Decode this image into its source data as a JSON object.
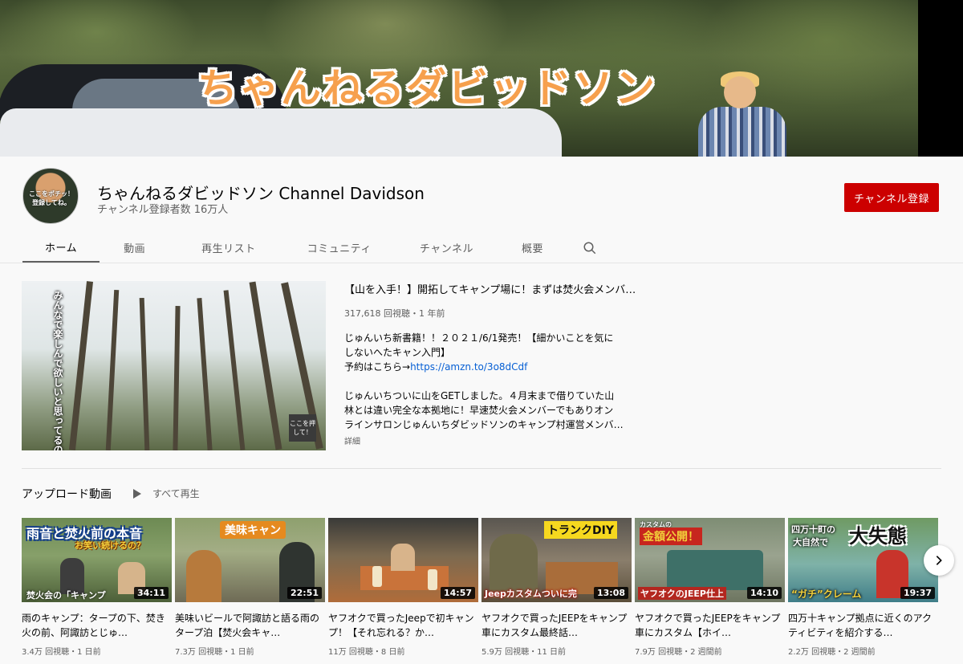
{
  "banner": {
    "title": "ちゃんねるダビッドソン"
  },
  "channel": {
    "name": "ちゃんねるダビッドソン Channel Davidson",
    "subscribers": "チャンネル登録者数 16万人",
    "avatar_text": "ここをポチッ！登録してね。",
    "subscribe_label": "チャンネル登録"
  },
  "tabs": [
    {
      "label": "ホーム",
      "active": true
    },
    {
      "label": "動画"
    },
    {
      "label": "再生リスト"
    },
    {
      "label": "コミュニティ"
    },
    {
      "label": "チャンネル"
    },
    {
      "label": "概要"
    }
  ],
  "featured": {
    "thumb_vertical_text": "みんなで楽しんで欲しいと思ってるので",
    "thumb_badge": "ここを押して！",
    "title": "【山を入手！】開拓してキャンプ場に！まずは焚火会メンバー…",
    "meta": "317,618 回視聴・1 年前",
    "desc_line1": "じゅんいち新書籍！！２０２１/6/1発売！【細かいことを気に",
    "desc_line2": "しないへたキャン入門】",
    "desc_line3_prefix": "予約はこちら→",
    "desc_link": "https://amzn.to/3o8dCdf",
    "desc_line4": "じゅんいちついに山をGETしました。４月末まで借りていた山",
    "desc_line5": "林とは違い完全な本拠地に！早速焚火会メンバーでもありオン",
    "desc_line6": "ラインサロンじゅんいちダビッドソンのキャンプ村運営メンバ…",
    "more": "詳細"
  },
  "uploads": {
    "title": "アップロード動画",
    "play_all": "すべて再生",
    "videos": [
      {
        "title": "雨のキャンプ：タープの下、焚き火の前、阿諏訪とじゅ…",
        "meta": "3.4万 回視聴・1 日前",
        "duration": "34:11",
        "overlay1": "雨音と焚火前の本音",
        "overlay2": "お笑い続けるの？",
        "overlay3": "焚火会の「キャンプ"
      },
      {
        "title": "美味いビールで阿諏訪と語る雨のタープ泊【焚火会キャ…",
        "meta": "7.3万 回視聴・1 日前",
        "duration": "22:51",
        "overlay1": "美味キャン"
      },
      {
        "title": "ヤフオクで買ったJeepで初キャンプ！【それ忘れる？か…",
        "meta": "11万 回視聴・8 日前",
        "duration": "14:57"
      },
      {
        "title": "ヤフオクで買ったJEEPをキャンプ車にカスタム最終話…",
        "meta": "5.9万 回視聴・11 日前",
        "duration": "13:08",
        "overlay1": "トランクDIY",
        "overlay2": "Jeepカスタムついに完"
      },
      {
        "title": "ヤフオクで買ったJEEPをキャンプ車にカスタム【ホイ…",
        "meta": "7.9万 回視聴・2 週間前",
        "duration": "14:10",
        "overlay0": "カスタムの",
        "overlay1": "金額公開！",
        "overlay2": "ヤフオクのJEEP仕上"
      },
      {
        "title": "四万十キャンプ拠点に近くのアクティビティを紹介する…",
        "meta": "2.2万 回視聴・2 週間前",
        "duration": "19:37",
        "overlay1": "四万十町の",
        "overlay1b": "大自然で",
        "overlay2": "大失態",
        "overlay3": "“ガチ”クレーム"
      }
    ]
  },
  "colors": {
    "accent_red": "#cc0000",
    "link_blue": "#065fd4",
    "banner_title_orange": "#f6a04d"
  },
  "icons": {
    "search": "search-icon",
    "play": "play-icon",
    "next": "chevron-right-icon"
  }
}
